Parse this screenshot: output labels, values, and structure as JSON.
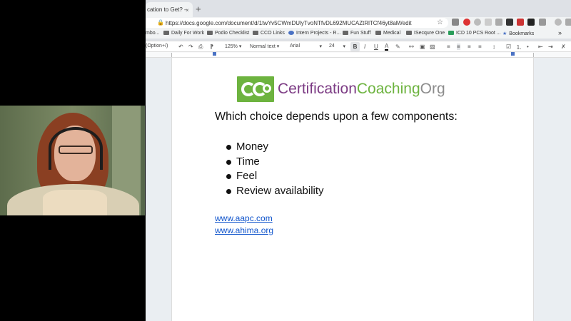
{
  "browser": {
    "tab_title": "cation to Get? - ",
    "tab_close": "×",
    "new_tab": "+",
    "url": "https://docs.google.com/document/d/1twYv5CWmDUlyTvoNTfvDL692MUCAZtRlTCf46yt8aM/edit",
    "bookmarks": [
      {
        "label": "mbo..."
      },
      {
        "label": "Daily For Work"
      },
      {
        "label": "Podio Checklist"
      },
      {
        "label": "CCO Links"
      },
      {
        "label": "Intern Projects - R..."
      },
      {
        "label": "Fun Stuff"
      },
      {
        "label": "Medical"
      },
      {
        "label": "ISecqure One"
      },
      {
        "label": "ICD 10 PCS Root ..."
      },
      {
        "label": "Bookmarks"
      }
    ],
    "bookmarks_more": "»"
  },
  "toolbar": {
    "style_hint": "(Option+/)",
    "zoom": "125%",
    "paragraph_style": "Normal text",
    "font": "Arial",
    "font_size": "24",
    "bold": "B",
    "italic": "I",
    "underline": "U",
    "text_color": "A"
  },
  "document": {
    "logo": {
      "part1": "Certification",
      "part2": "Coaching",
      "part3": "Org"
    },
    "prompt": "Which choice depends upon a few components:",
    "bullets": [
      "Money",
      "Time",
      "Feel",
      "Review availability"
    ],
    "links": [
      "www.aapc.com",
      "www.ahima.org"
    ]
  },
  "colors": {
    "logo_green": "#6db33f",
    "logo_purple": "#7c3b84",
    "link_blue": "#1155cc"
  }
}
